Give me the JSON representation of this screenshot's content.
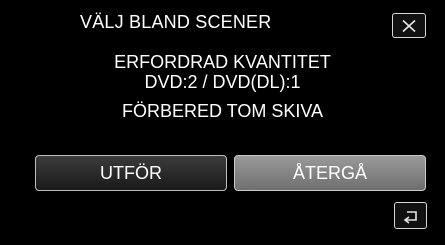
{
  "dialog": {
    "title": "VÄLJ BLAND SCENER",
    "message_line1": "ERFORDRAD KVANTITET",
    "message_line2": "DVD:2 / DVD(DL):1",
    "message_line3": "FÖRBERED TOM SKIVA"
  },
  "buttons": {
    "execute_label": "UTFÖR",
    "return_label": "ÅTERGÅ",
    "close_icon": "close-icon",
    "back_icon": "return-arrow-icon"
  },
  "colors": {
    "background": "#000000",
    "text": "#ffffff",
    "execute_button": "#2a2a2a",
    "return_button": "#858585"
  }
}
